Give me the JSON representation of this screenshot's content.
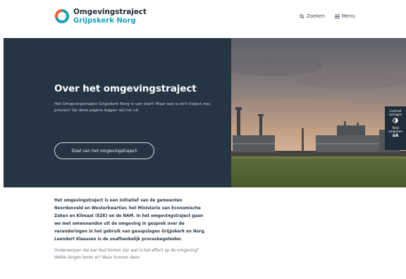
{
  "header": {
    "brand_title": "Omgevingstraject",
    "brand_subtitle": "Grijpskerk Norg",
    "search_label": "Zoeken",
    "menu_label": "Menu"
  },
  "hero": {
    "title": "Over het omgevingstraject",
    "text": "Het Omgevingstraject Grijpskerk Norg is van start! Maar wat is zo'n traject nou precies? Op deze pagina leggen wij het uit.",
    "button_label": "Doel van het omgevingstraject"
  },
  "accessibility": {
    "contrast_label": "Contrast verhogen",
    "text_label": "Tekst vergroten",
    "text_icon": "aA"
  },
  "content": {
    "intro": "Het omgevingstraject is een initiatief van de gemeenten Noordenveld en Westerkwartier, het Ministerie van Economische Zaken en Klimaat (EZK) en de NAM. In het omgevingstraject gaan we met omwonenden uit de omgeving in gesprek over de veranderingen in het gebruik van gasopslagen Grijpskerk en Norg. Leendert Klaassen is de onafhankelijk procesbegeleider.",
    "paragraph": "Onderwerpen die aan bod komen zijn wat is het effect op de omgeving? Welke zorgen leven er? Waar kunnen deze"
  },
  "colors": {
    "navy": "#253544",
    "teal": "#16a2b5",
    "orange": "#e8643a"
  },
  "icons": [
    "logo-icon",
    "search-icon",
    "menu-icon",
    "contrast-icon"
  ]
}
